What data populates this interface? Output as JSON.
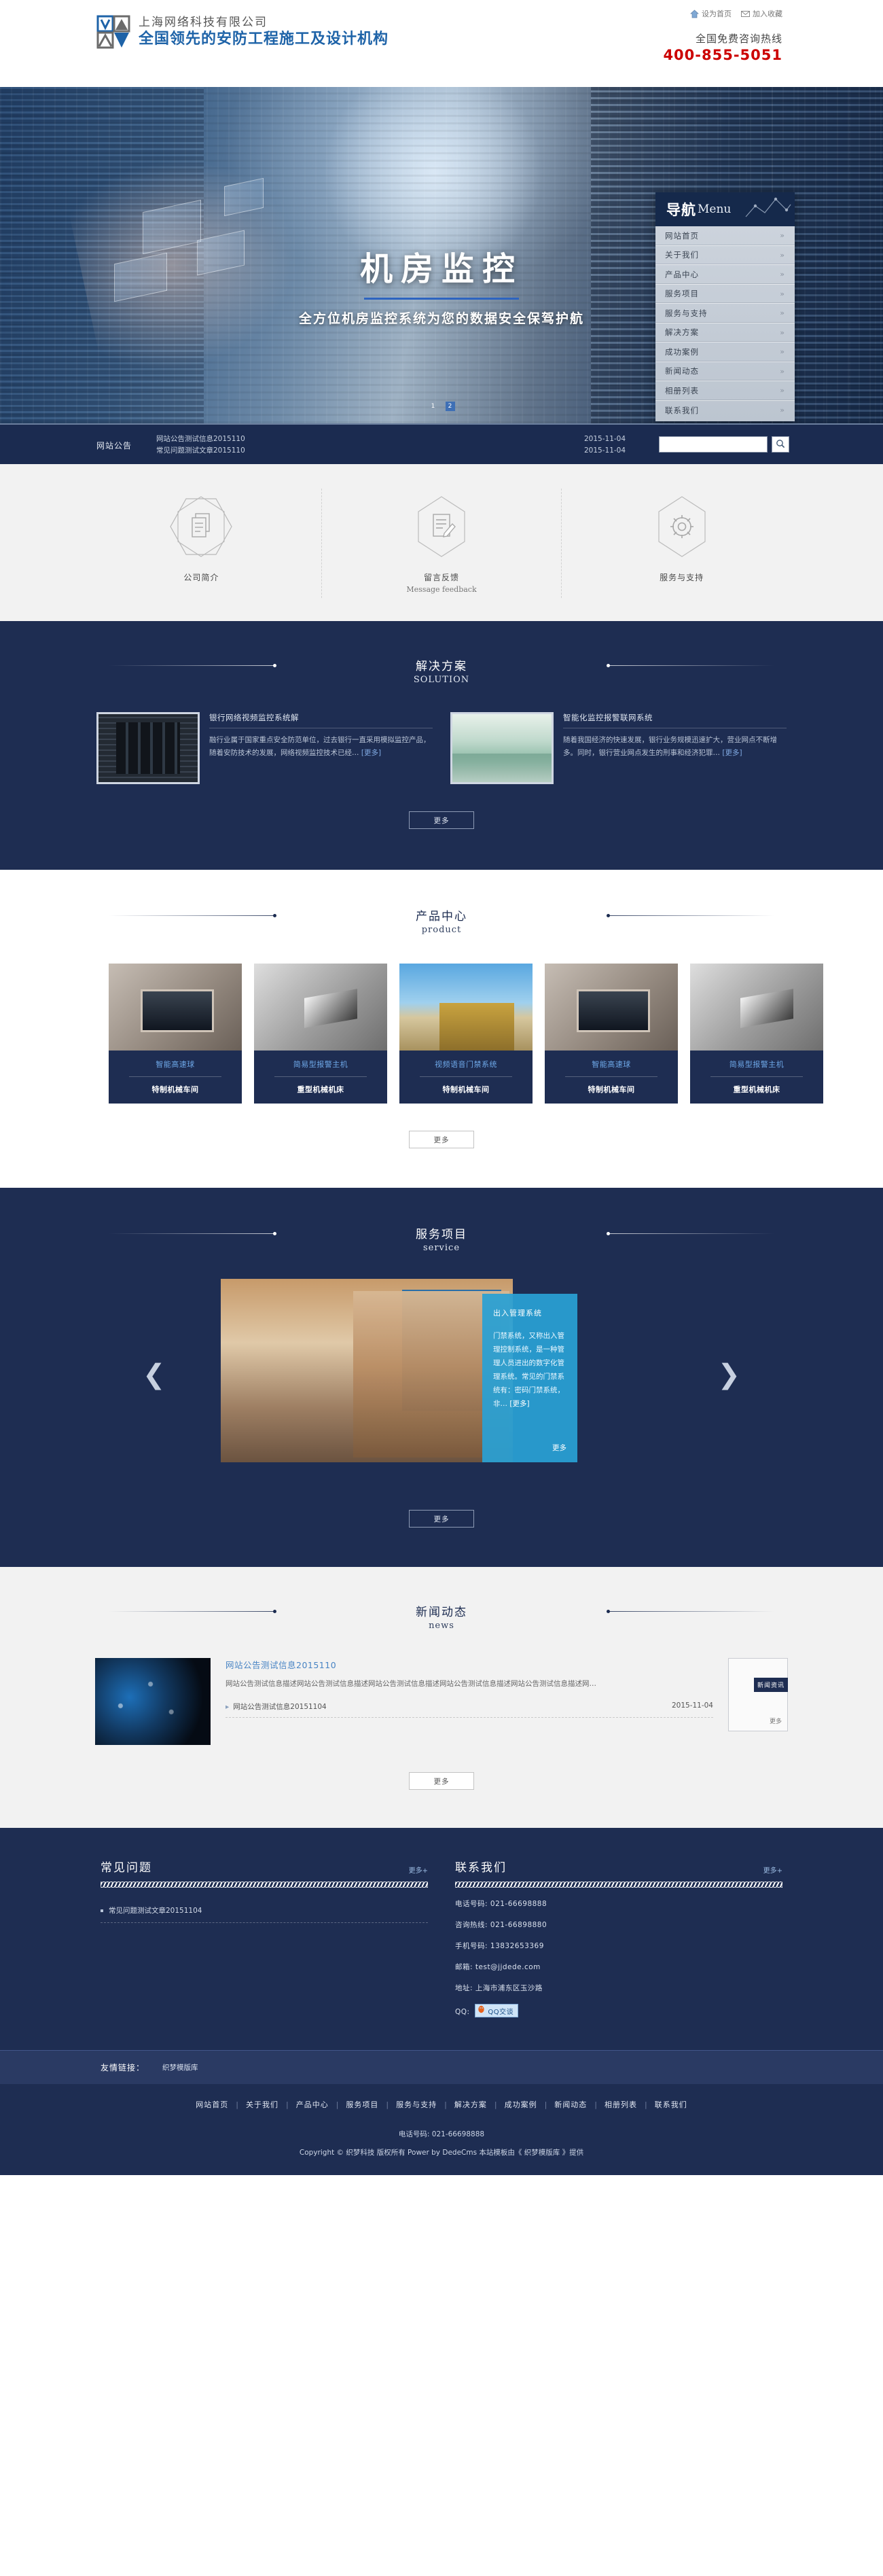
{
  "header": {
    "company_name": "上海网络科技有限公司",
    "slogan": "全国领先的安防工程施工及设计机构",
    "set_home": "设为首页",
    "add_favorite": "加入收藏",
    "hotline_label": "全国免费咨询热线",
    "hotline_number": "400-855-5051"
  },
  "banner": {
    "title": "机房监控",
    "subtitle": "全方位机房监控系统为您的数据安全保驾护航",
    "slides": [
      "1",
      "2"
    ],
    "active_slide": "2"
  },
  "nav": {
    "title_cn": "导航",
    "title_en": "Menu",
    "items": [
      {
        "label": "网站首页"
      },
      {
        "label": "关于我们"
      },
      {
        "label": "产品中心"
      },
      {
        "label": "服务项目"
      },
      {
        "label": "服务与支持"
      },
      {
        "label": "解决方案"
      },
      {
        "label": "成功案例"
      },
      {
        "label": "新闻动态"
      },
      {
        "label": "相册列表"
      },
      {
        "label": "联系我们"
      }
    ]
  },
  "notice": {
    "label": "网站公告",
    "rows": [
      {
        "text": "网站公告测试信息2015110",
        "date": "2015-11-04"
      },
      {
        "text": "常见问题测试文章2015110",
        "date": "2015-11-04"
      }
    ],
    "search_placeholder": "",
    "search_value": ""
  },
  "features": [
    {
      "cn": "公司简介",
      "en": "",
      "icon": "documents-icon"
    },
    {
      "cn": "留言反馈",
      "en": "Message feedback",
      "icon": "message-edit-icon"
    },
    {
      "cn": "服务与支持",
      "en": "",
      "icon": "gear-icon"
    }
  ],
  "solution": {
    "title_cn": "解决方案",
    "title_en": "SOLUTION",
    "items": [
      {
        "title": "银行网络视频监控系统解",
        "desc": "融行业属于国家重点安全防范单位，过去银行一直采用模拟监控产品，随着安防技术的发展，网络视频监控技术已经…",
        "more": "[更多]"
      },
      {
        "title": "智能化监控报警联网系统",
        "desc": "随着我国经济的快速发展，银行业务规模迅速扩大，营业网点不断增多。同时，银行营业网点发生的刑事和经济犯罪…",
        "more": "[更多]"
      }
    ],
    "more_button": "更多"
  },
  "product": {
    "title_cn": "产品中心",
    "title_en": "product",
    "items": [
      {
        "name": "智能高速球",
        "sub": "特制机械车间",
        "photo": "ph-elev"
      },
      {
        "name": "简易型报警主机",
        "sub": "重型机械机床",
        "photo": "ph-cam"
      },
      {
        "name": "视频语音门禁系统",
        "sub": "特制机械车间",
        "photo": "ph-build"
      },
      {
        "name": "智能高速球",
        "sub": "特制机械车间",
        "photo": "ph-elev"
      },
      {
        "name": "简易型报警主机",
        "sub": "重型机械机床",
        "photo": "ph-cam"
      }
    ],
    "more_button": "更多"
  },
  "service": {
    "title_cn": "服务项目",
    "title_en": "service",
    "panel_title": "出入管理系统",
    "panel_desc": "门禁系统，又称出入管理控制系统，是一种管理人员进出的数字化管理系统。常见的门禁系统有：密码门禁系统，非…",
    "panel_more_inline": "[更多]",
    "panel_more": "更多",
    "prev_arrow": "❮",
    "next_arrow": "❯",
    "more_button": "更多"
  },
  "news": {
    "title_cn": "新闻动态",
    "title_en": "news",
    "featured_title": "网站公告测试信息2015110",
    "featured_desc": "网站公告测试信息描述网站公告测试信息描述网站公告测试信息描述网站公告测试信息描述网站公告测试信息描述网…",
    "list": [
      {
        "text": "网站公告测试信息20151104",
        "date": "2015-11-04"
      }
    ],
    "side_tab": "新闻资讯",
    "side_more": "更多",
    "more_button": "更多"
  },
  "faq": {
    "title": "常见问题",
    "more": "更多+",
    "items": [
      {
        "text": "常见问题测试文章20151104"
      }
    ]
  },
  "contact": {
    "title": "联系我们",
    "more": "更多+",
    "rows": [
      {
        "label": "电话号码:",
        "value": "021-66698888"
      },
      {
        "label": "咨询热线:",
        "value": "021-66898880"
      },
      {
        "label": "手机号码:",
        "value": "13832653369"
      },
      {
        "label": "邮箱:",
        "value": "test@jjdede.com"
      },
      {
        "label": "地址:",
        "value": "上海市浦东区玉沙路"
      }
    ],
    "qq_label": "QQ:",
    "qq_button": "QQ交谈"
  },
  "friendlinks": {
    "label": "友情链接：",
    "links": [
      "织梦模版库"
    ]
  },
  "footer": {
    "nav": [
      "网站首页",
      "关于我们",
      "产品中心",
      "服务项目",
      "服务与支持",
      "解决方案",
      "成功案例",
      "新闻动态",
      "相册列表",
      "联系我们"
    ],
    "separator": "|",
    "tel": "电话号码: 021-66698888",
    "copyright": "Copyright © 织梦科技 版权所有 Power by DedeCms 本站模板由《 织梦模版库 》提供"
  },
  "colors": {
    "brand_blue": "#1e63a8",
    "dark_navy": "#1e2d52",
    "accent_red": "#cc0000",
    "link_blue": "#4884c4",
    "cyan_panel": "#29a0d4"
  }
}
